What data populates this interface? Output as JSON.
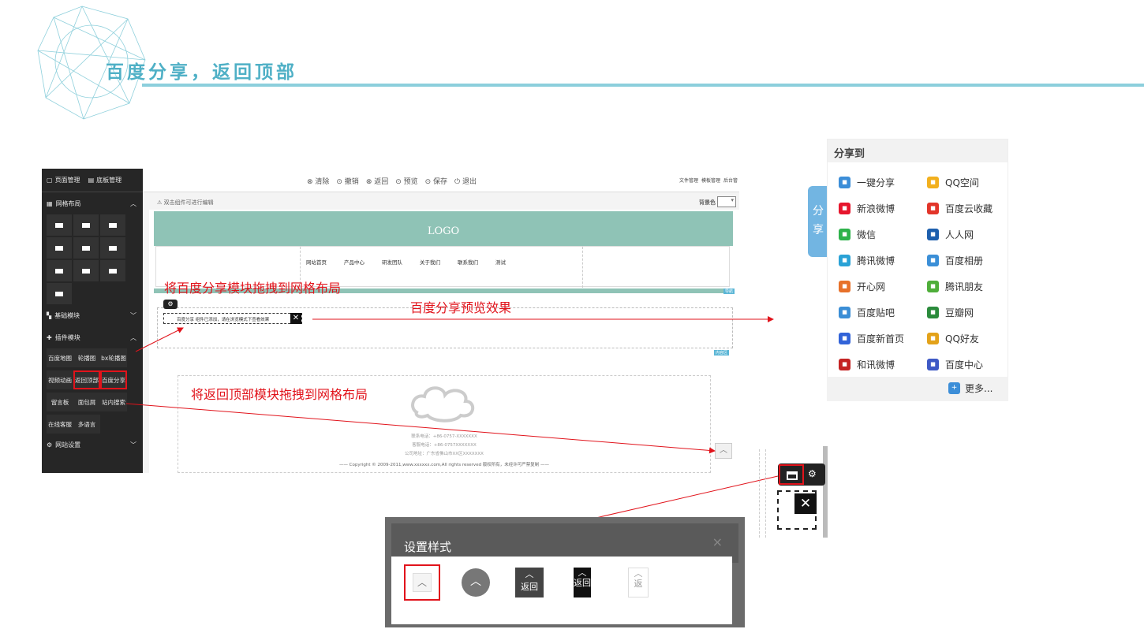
{
  "title": "百度分享，返回顶部",
  "editor": {
    "left_tabs": [
      "页面管理",
      "底板管理"
    ],
    "sections": {
      "grid_layout": "网格布局",
      "basic_modules": "基础模块",
      "plugin_modules": "插件模块",
      "site_settings": "网站设置"
    },
    "plugins": [
      "百度地图",
      "轮播图",
      "bx轮播图",
      "视频动画",
      "返回顶部",
      "百度分享",
      "留言板",
      "面包屑",
      "站内搜索",
      "在线客服",
      "多语言"
    ],
    "toolbar": [
      "⊗ 清除",
      "⊙ 撤销",
      "⊗ 返回",
      "⊙ 预览",
      "⊙ 保存",
      "⏻ 退出"
    ],
    "top_right": [
      "文件管理",
      "模板管理",
      "后台管"
    ],
    "hint": "双击组件可进行编辑",
    "bg_label": "背景色",
    "logo": "LOGO",
    "nav_items": [
      "网站首页",
      "产品中心",
      "研发团队",
      "关于我们",
      "联系我们",
      "测试"
    ],
    "share_placeholder": "百度分享 组件已添加，请在浏览模式下查看效果",
    "footer_lines": [
      "联系电话：+86-0757-XXXXXXX",
      "客服电话：+86-0757XXXXXXX",
      "公司地址：广东省佛山市XX区XXXXXXX"
    ],
    "copyright": "—— Copyright © 2009-2011,www.xxxxxx.com,All rights reserved 版权所有，未经许可严禁复制 ——",
    "tags": [
      "导航",
      "内容区"
    ]
  },
  "annotations": {
    "drag_share": "将百度分享模块拖拽到网格布局",
    "share_preview": "百度分享预览效果",
    "drag_backtop": "将返回顶部模块拖拽到网格布局"
  },
  "share_panel": {
    "tab": [
      "分",
      "享"
    ],
    "header": "分享到",
    "items": [
      {
        "label": "一键分享",
        "icon": "one-click-share-icon",
        "color": "#3c8ed8"
      },
      {
        "label": "QQ空间",
        "icon": "qzone-icon",
        "color": "#f2b01e"
      },
      {
        "label": "新浪微博",
        "icon": "weibo-icon",
        "color": "#e6162d"
      },
      {
        "label": "百度云收藏",
        "icon": "heart-icon",
        "color": "#e2352a"
      },
      {
        "label": "微信",
        "icon": "wechat-icon",
        "color": "#2eb24b"
      },
      {
        "label": "人人网",
        "icon": "renren-icon",
        "color": "#1d5fad"
      },
      {
        "label": "腾讯微博",
        "icon": "tencent-weibo-icon",
        "color": "#2aa2d6"
      },
      {
        "label": "百度相册",
        "icon": "baidu-album-icon",
        "color": "#3b8fd7"
      },
      {
        "label": "开心网",
        "icon": "kaixin-icon",
        "color": "#e7712a"
      },
      {
        "label": "腾讯朋友",
        "icon": "tencent-friend-icon",
        "color": "#4fae3a"
      },
      {
        "label": "百度贴吧",
        "icon": "tieba-icon",
        "color": "#3b8ed6"
      },
      {
        "label": "豆瓣网",
        "icon": "douban-icon",
        "color": "#2b8b3c"
      },
      {
        "label": "百度新首页",
        "icon": "baidu-home-icon",
        "color": "#3263d8"
      },
      {
        "label": "QQ好友",
        "icon": "qq-friend-icon",
        "color": "#e3a21a"
      },
      {
        "label": "和讯微博",
        "icon": "hexun-icon",
        "color": "#c42323"
      },
      {
        "label": "百度中心",
        "icon": "baidu-center-icon",
        "color": "#3e59c5"
      }
    ],
    "more": "更多..."
  },
  "dialog": {
    "title": "设置样式",
    "close": "×",
    "opt3": "返回",
    "opt4": "返回",
    "opt5": "返"
  }
}
